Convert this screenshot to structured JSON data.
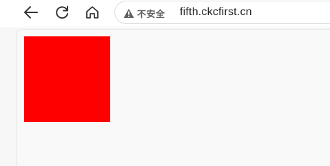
{
  "toolbar": {
    "back_icon": "arrow-left-icon",
    "reload_icon": "reload-icon",
    "home_icon": "home-icon"
  },
  "address_bar": {
    "security_icon": "warning-triangle-icon",
    "security_label": "不安全",
    "url": "fifth.ckcfirst.cn"
  },
  "page": {
    "box_color": "#ff0000"
  },
  "colors": {
    "icon": "#333333",
    "warning_icon": "#5f5f5f"
  }
}
